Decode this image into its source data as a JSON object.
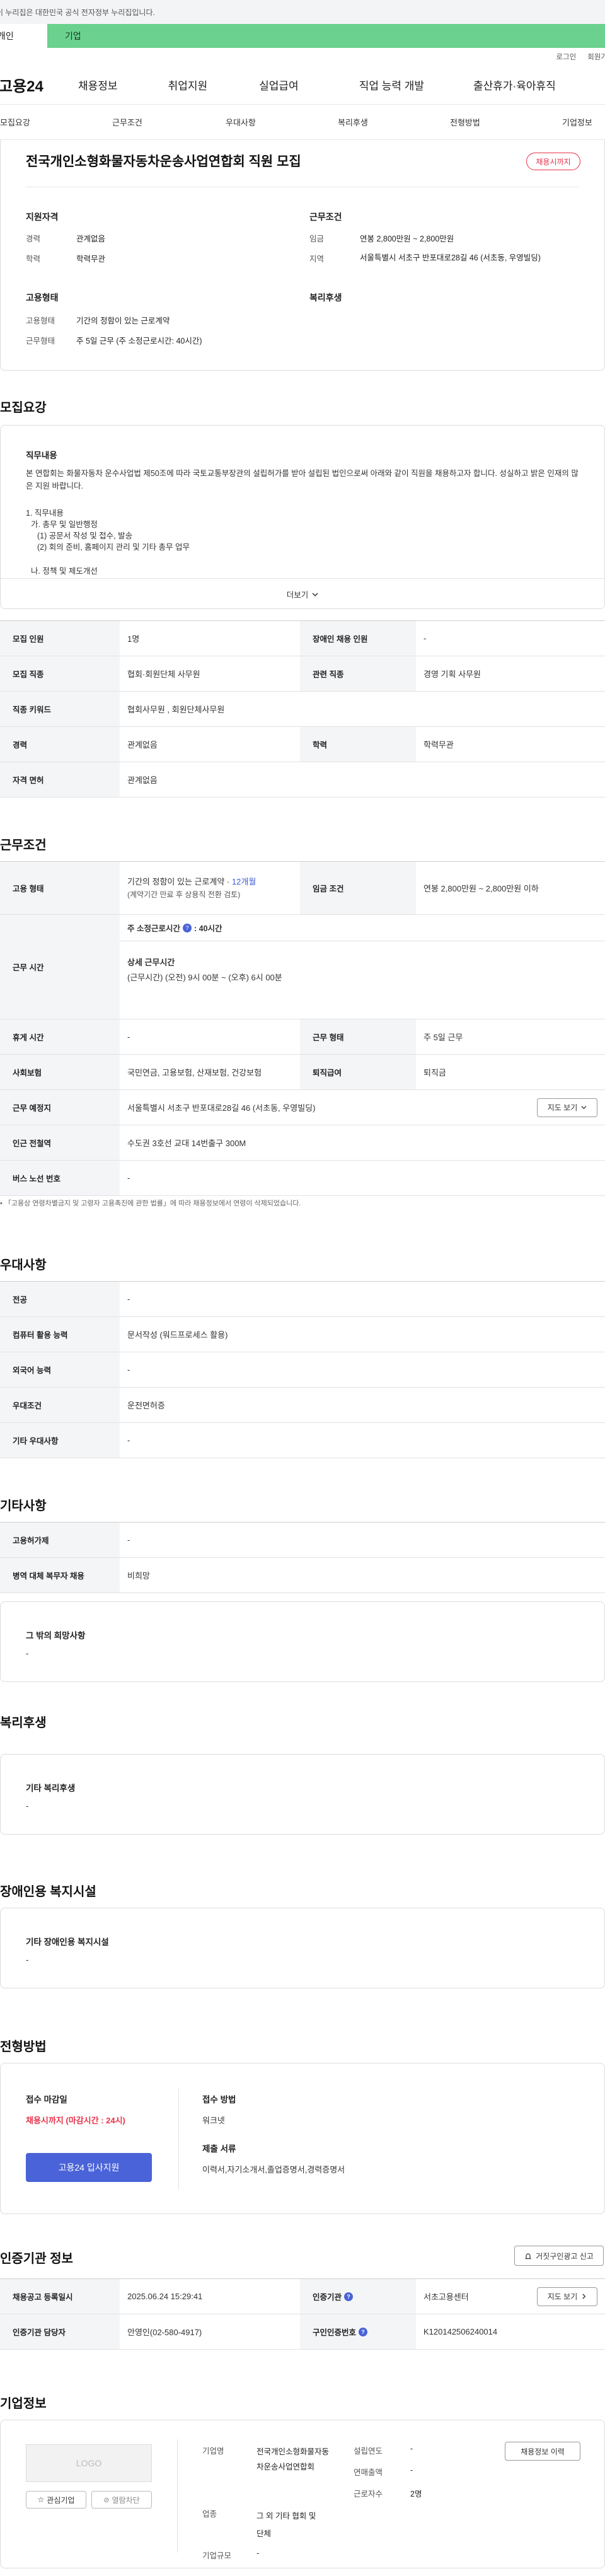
{
  "gov_banner": "이 누리집은 대한민국 공식 전자정부 누리집입니다.",
  "user_tabs": {
    "personal": "개인",
    "company": "기업"
  },
  "utility": {
    "login": "로그인",
    "signup": "회원가"
  },
  "logo": "고용24",
  "gnb": [
    "채용정보",
    "취업지원",
    "실업급여",
    "직업 능력 개발",
    "출산휴가·육아휴직"
  ],
  "subnav": [
    "모집요강",
    "근무조건",
    "우대사항",
    "복리후생",
    "전형방법",
    "기업정보"
  ],
  "header": {
    "title": "전국개인소형화물자동차운송사업연합회 직원 모집",
    "badge": "채용시까지",
    "qual_title": "지원자격",
    "career_label": "경력",
    "career_value": "관계없음",
    "edu_label": "학력",
    "edu_value": "학력무관",
    "work_title": "근무조건",
    "wage_label": "임금",
    "wage_value": "연봉 2,800만원 ~ 2,800만원",
    "area_label": "지역",
    "area_value": "서울특별시 서초구 반포대로28길 46 (서초동, 우영빌딩)",
    "emp_title": "고용형태",
    "emptype_label": "고용형태",
    "emptype_value": "기간의 정함이 있는 근로계약",
    "worktype_label": "근무형태",
    "worktype_value": "주 5일 근무 (주 소정근로시간: 40시간)",
    "welfare_title": "복리후생"
  },
  "recruit": {
    "section_title": "모집요강",
    "duty_title": "직무내용",
    "duty_text": "본 연합회는 화물자동차 운수사업법 제50조에 따라 국토교통부장관의 설립허가를 받아 설립된 법인으로써 아래와 같이 직원을 채용하고자 합니다. 성실하고 밝은 인재의 많은 지원 바랍니다.",
    "duty_lines": [
      "1. 직무내용",
      "가. 총무 및 일반행정",
      "(1) 공문서 작성 및 접수, 발송",
      "(2) 회의 준비, 홈페이지 관리 및 기타 총무 업무",
      "나. 정책 및 제도개선"
    ],
    "more": "더보기",
    "rows": [
      {
        "k1": "모집 인원",
        "v1": "1명",
        "k2": "장애인 채용 인원",
        "v2": "-"
      },
      {
        "k1": "모집 직종",
        "v1": "협회·회원단체 사무원",
        "k2": "관련 직종",
        "v2": "경영 기획 사무원"
      },
      {
        "k1": "직종 키워드",
        "v1": "협회사무원 , 회원단체사무원"
      },
      {
        "k1": "경력",
        "v1": "관계없음",
        "k2": "학력",
        "v2": "학력무관"
      },
      {
        "k1": "자격 면허",
        "v1": "관계없음"
      }
    ]
  },
  "work": {
    "section_title": "근무조건",
    "emp_label": "고용 형태",
    "emp_value": "기간의 정함이 있는 근로계약",
    "emp_period": "12개월",
    "emp_note": "(계약기간 만료 후 상용직 전환 검토)",
    "wage_label": "임금 조건",
    "wage_value": "연봉 2,800만원 ~ 2,800만원 이하",
    "time_label": "근무 시간",
    "weekly_label": "주 소정근로시간",
    "weekly_value": ": 40시간",
    "detail_label": "상세 근무시간",
    "detail_value": "(근무시간) (오전) 9시 00분 ~ (오후) 6시 00분",
    "holiday_label": "휴게 시간",
    "holiday_value": "-",
    "worktype_label": "근무 형태",
    "worktype_value": "주 5일 근무",
    "insure_label": "사회보험",
    "insure_value": "국민연금, 고용보험, 산재보험, 건강보험",
    "retire_label": "퇴직급여",
    "retire_value": "퇴직금",
    "place_label": "근무 예정지",
    "place_value": "서울특별시 서초구 반포대로28길 46 (서초동, 우영빌딩)",
    "map_btn": "지도 보기",
    "subway_label": "인근 전철역",
    "subway_value": "수도권 3호선 교대 14번출구 300M",
    "bus_label": "버스 노선 번호",
    "bus_value": "-",
    "note": "「고용상 연령차별금지 및 고령자 고용촉진에 관한 법률」에 따라 채용정보에서 연령이 삭제되었습니다."
  },
  "pref": {
    "section_title": "우대사항",
    "rows": [
      {
        "k": "전공",
        "v": "-"
      },
      {
        "k": "컴퓨터 활용 능력",
        "v": "문서작성 (워드프로세스 활용)"
      },
      {
        "k": "외국어 능력",
        "v": "-"
      },
      {
        "k": "우대조건",
        "v": "운전면허증"
      },
      {
        "k": "기타 우대사항",
        "v": "-"
      }
    ]
  },
  "etc": {
    "section_title": "기타사항",
    "rows": [
      {
        "k": "고용허가제",
        "v": "-"
      },
      {
        "k": "병역 대체 복무자 채용",
        "v": "비희망"
      }
    ],
    "box_title": "그 밖의 희망사항",
    "box_value": "-"
  },
  "welfare": {
    "section_title": "복리후생",
    "box_title": "기타 복리후생",
    "box_value": "-"
  },
  "disabled": {
    "section_title": "장애인용 복지시설",
    "box_title": "기타 장애인용 복지시설",
    "box_value": "-"
  },
  "process": {
    "section_title": "전형방법",
    "deadline_label": "접수 마감일",
    "deadline_value": "채용시까지 (마감시간 : 24시)",
    "method_label": "접수 방법",
    "method_value": "워크넷",
    "docs_label": "제출 서류",
    "docs_value": "이력서,자기소개서,졸업증명서,경력증명서",
    "apply_btn": "고용24 입사지원"
  },
  "cert": {
    "section_title": "인증기관 정보",
    "report_btn": "거짓구인광고 신고",
    "reg_label": "채용공고 등록일시",
    "reg_value": "2025.06.24 15:29:41",
    "org_label": "인증기관",
    "org_value": "서초고용센터",
    "map_btn": "지도 보기",
    "mgr_label": "인증기관 담당자",
    "mgr_value": "안영인(02-580-4917)",
    "num_label": "구인인증번호",
    "num_value": "K120142506240014"
  },
  "company": {
    "section_title": "기업정보",
    "logo_text": "LOGO",
    "interest_btn": "관심기업",
    "block_btn": "열람차단",
    "name_label": "기업명",
    "name_value": "전국개인소형화물자동차운송사업연합회",
    "industry_label": "업종",
    "industry_value": "그 외 기타 협회 및 단체",
    "size_label": "기업규모",
    "size_value": "-",
    "year_label": "설립연도",
    "year_value": "-",
    "sales_label": "연매출액",
    "sales_value": "-",
    "staff_label": "근로자수",
    "staff_value": "2명",
    "history_btn": "채용정보 이력"
  },
  "colors": {
    "green": "#6ad28e",
    "red": "#e8334a",
    "blue": "#4a63d8"
  }
}
